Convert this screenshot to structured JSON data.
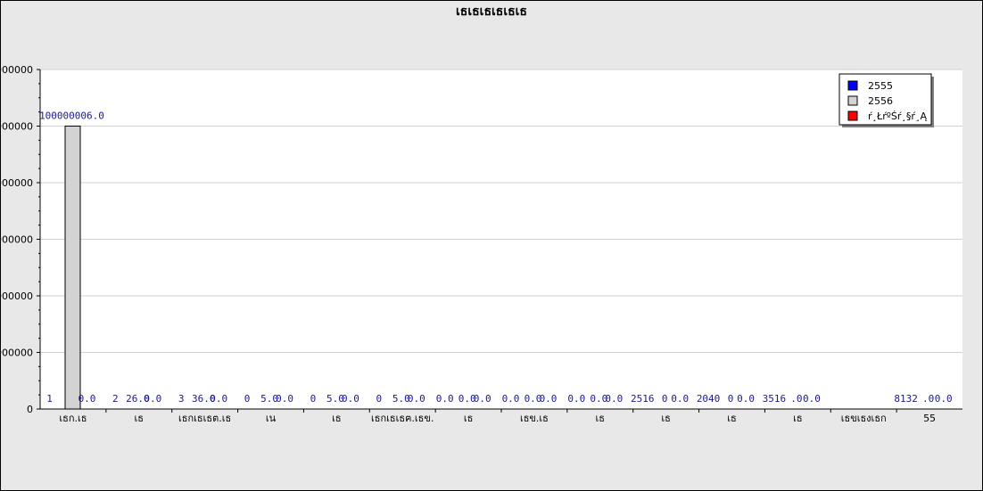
{
  "chart_data": {
    "type": "bar",
    "title": "เธเธเธเธเธเธ",
    "categories": [
      "เธก.เธ",
      "เธ",
      "เธกเธเธต.เธ",
      "เน",
      "เธ",
      "เธกเธเธฅ.เธข.",
      "เธ",
      "เธข.เธ",
      "เธ",
      "เธ",
      "เธ",
      "เธ",
      "เธขเธงเธก",
      "55"
    ],
    "series": [
      {
        "name": "2555",
        "color": "#0000ff",
        "values": [
          1,
          2,
          3,
          0,
          0,
          0,
          0,
          0,
          0,
          2516,
          2040,
          3516,
          0,
          8132
        ],
        "labels": [
          "1",
          "2",
          "3",
          "0",
          "0",
          "0",
          "0.0",
          "0.0",
          "0.0",
          "2516",
          "2040",
          "3516",
          "",
          "8132"
        ]
      },
      {
        "name": "2556",
        "color": "#d3d3d3",
        "values": [
          100000006,
          26,
          36,
          5,
          5,
          5,
          0,
          0,
          0,
          0,
          0,
          0,
          0,
          0
        ],
        "labels": [
          "100000006.0",
          "26.0",
          "36.0",
          "5.0",
          "5.0",
          "5.0",
          "0.0",
          "0.0",
          "0.0",
          "0",
          "0",
          ".0",
          "",
          ".0"
        ]
      },
      {
        "name": "ŕ¸ŁŕºŚŕ¸§ŕ¸Ą",
        "color": "#ff0000",
        "values": [
          0,
          0,
          0,
          0,
          0,
          0,
          0,
          0,
          0,
          0,
          0,
          0,
          0,
          0
        ],
        "labels": [
          "0.0",
          "0.0",
          "0.0",
          "0.0",
          "0.0",
          "0.0",
          "0.0",
          "0.0",
          "0.0",
          "0.0",
          "0.0",
          "0.0",
          "",
          "0.0"
        ]
      }
    ],
    "yticks": [
      "0",
      "0000000",
      "0000000",
      "0000000",
      "0000000",
      "0000000",
      "0000000"
    ],
    "ylim": [
      0,
      120000000
    ],
    "grid": true,
    "legend": "top-right"
  }
}
